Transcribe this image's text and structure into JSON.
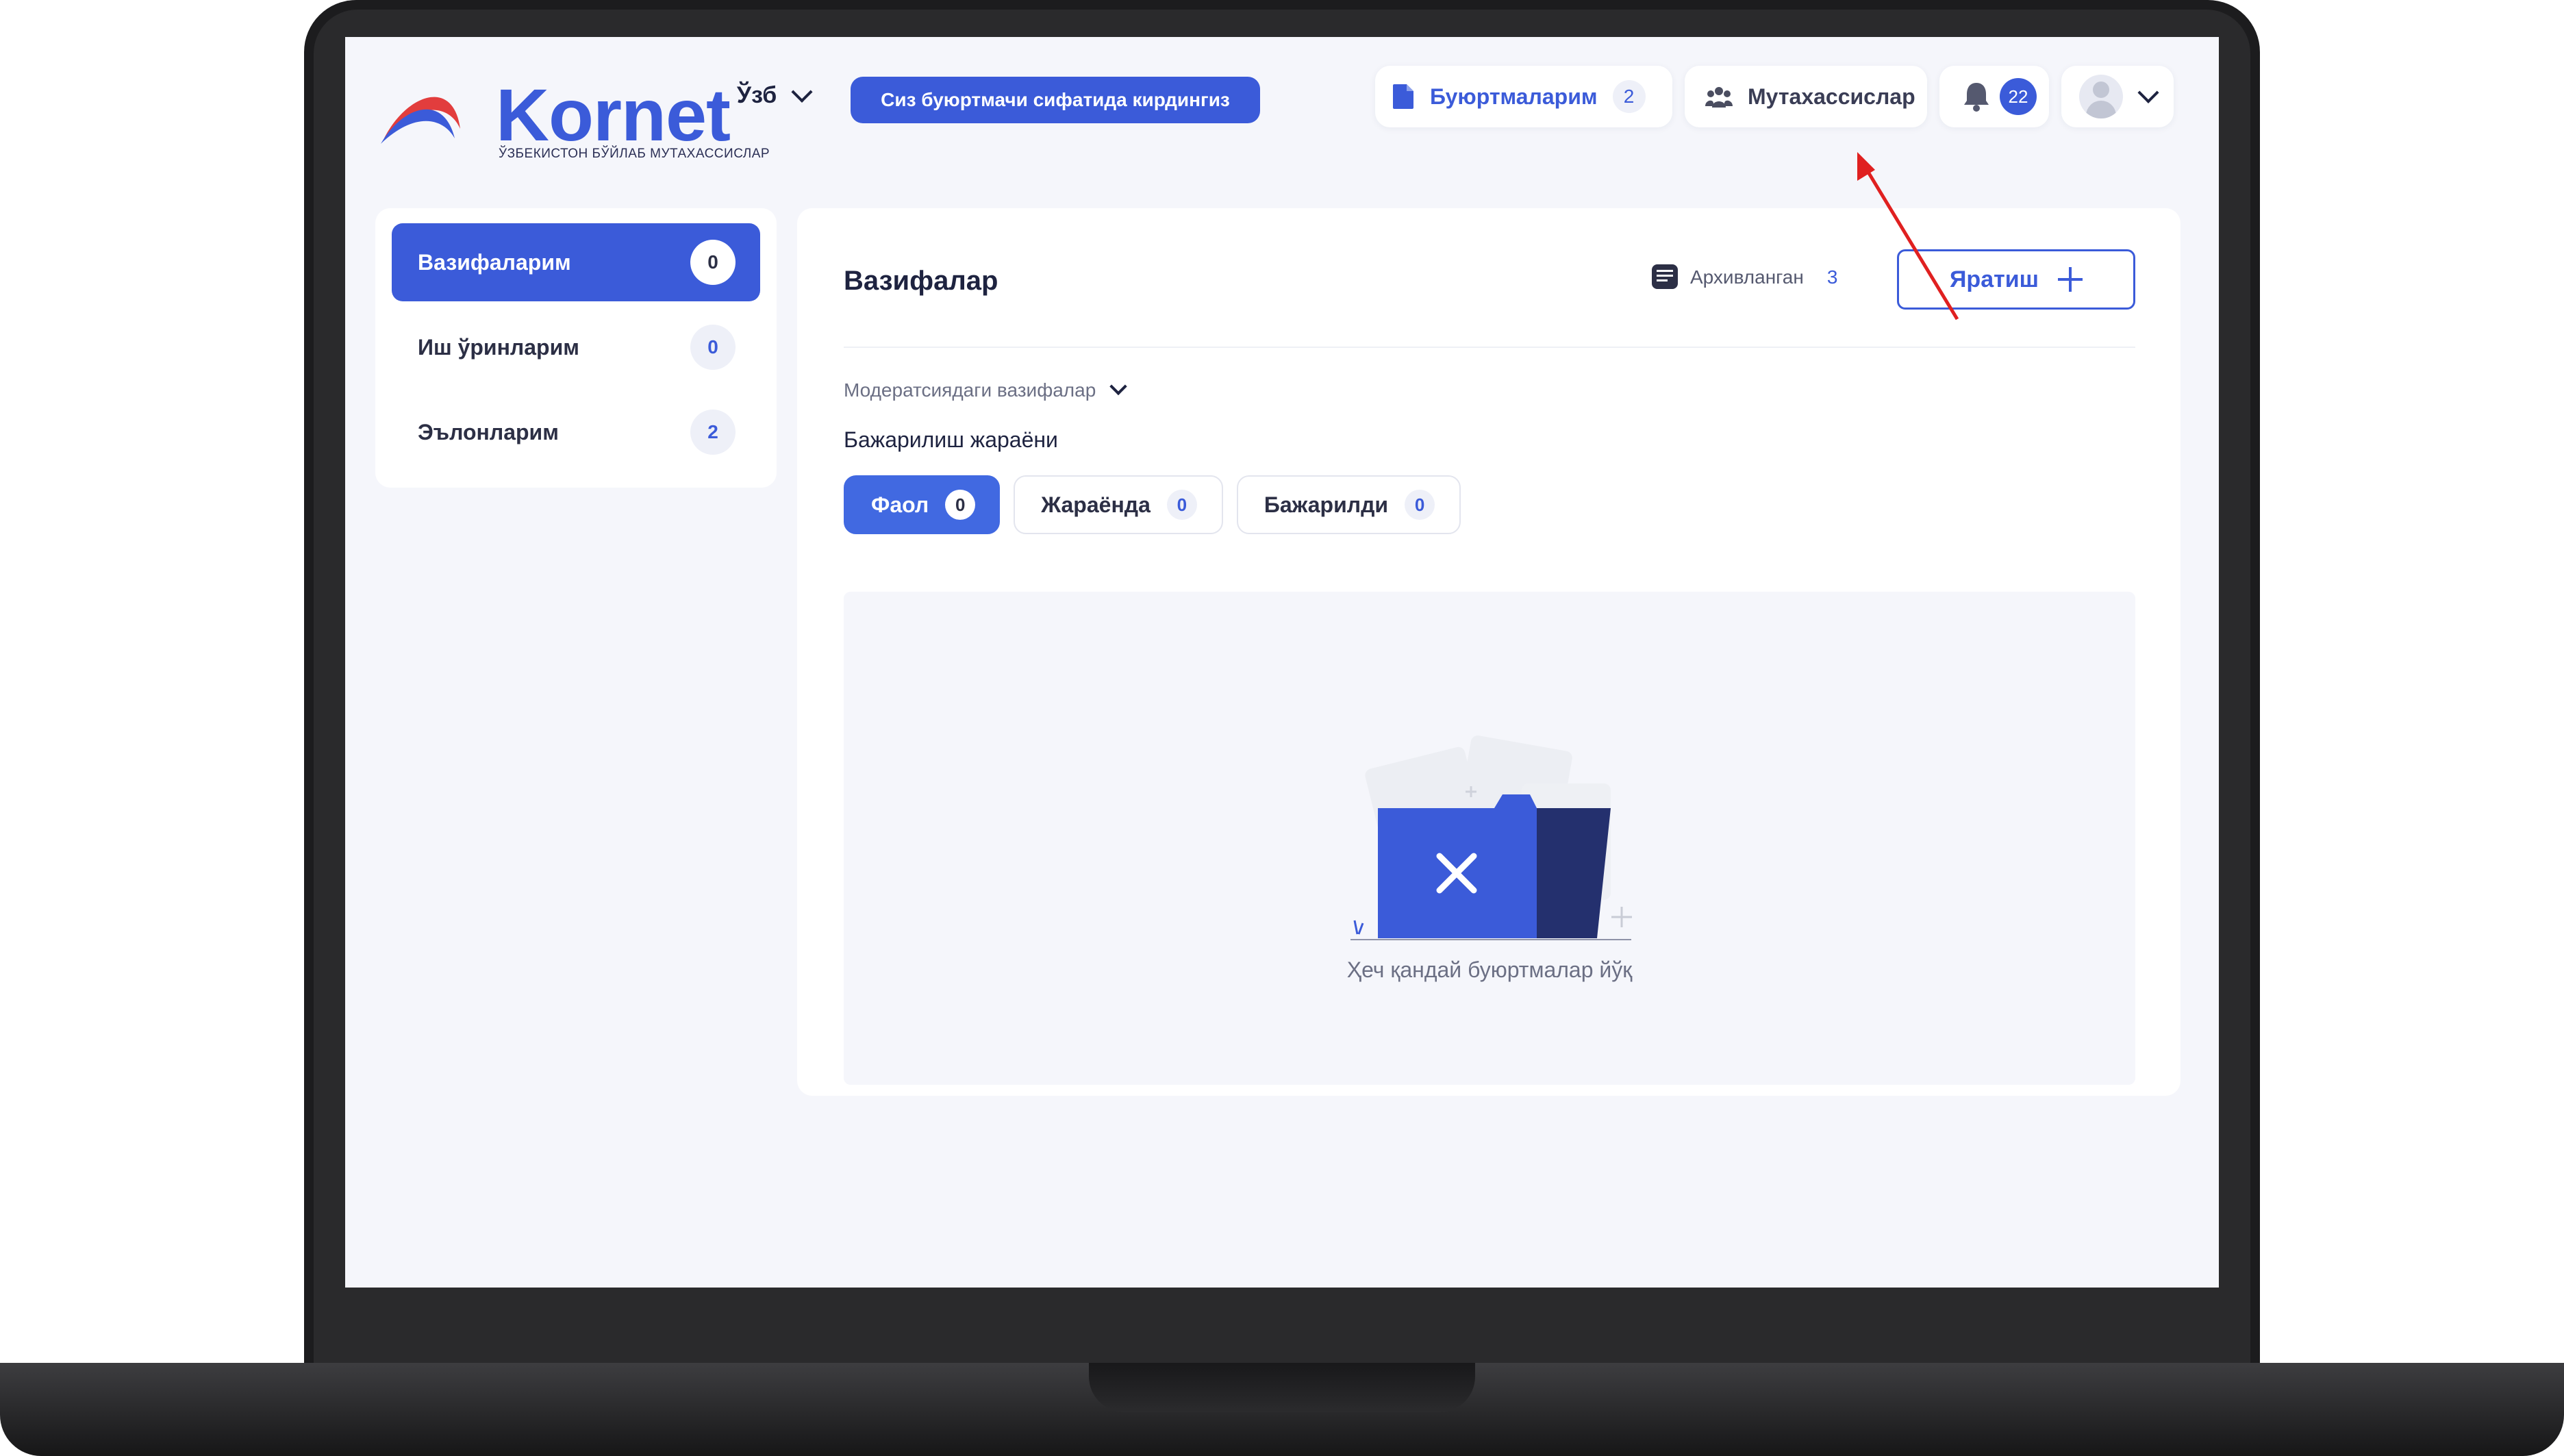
{
  "brand": {
    "name": "Kornet",
    "tagline": "ЎЗБЕКИСТОН БЎЙЛАБ МУТАХАССИСЛАР",
    "accent_color": "#3b5bd9"
  },
  "header": {
    "language": "Ўзб",
    "role_notice": "Сиз буюртмачи сифатида кирдингиз",
    "orders": {
      "label": "Буюртмаларим",
      "count": "2",
      "icon": "document-icon"
    },
    "specialists": {
      "label": "Мутахассислар",
      "icon": "users-icon"
    },
    "notifications": {
      "count": "22",
      "icon": "bell-icon"
    },
    "profile": {
      "icon": "avatar-icon"
    }
  },
  "sidebar": {
    "items": [
      {
        "label": "Вазифаларим",
        "count": "0",
        "active": true
      },
      {
        "label": "Иш ўринларим",
        "count": "0",
        "active": false
      },
      {
        "label": "Эълонларим",
        "count": "2",
        "active": false
      }
    ]
  },
  "main": {
    "title": "Вазифалар",
    "archived": {
      "label": "Архивланган",
      "count": "3",
      "icon": "archive-icon"
    },
    "create_label": "Яратиш",
    "moderation_label": "Модератсиядаги вазифалар",
    "section_label": "Бажарилиш жараёни",
    "tabs": [
      {
        "label": "Фаол",
        "count": "0",
        "active": true
      },
      {
        "label": "Жараёнда",
        "count": "0",
        "active": false
      },
      {
        "label": "Бажарилди",
        "count": "0",
        "active": false
      }
    ],
    "empty_text": "Ҳеч қандай буюртмалар йўқ",
    "empty_icon": "empty-folder-icon"
  }
}
